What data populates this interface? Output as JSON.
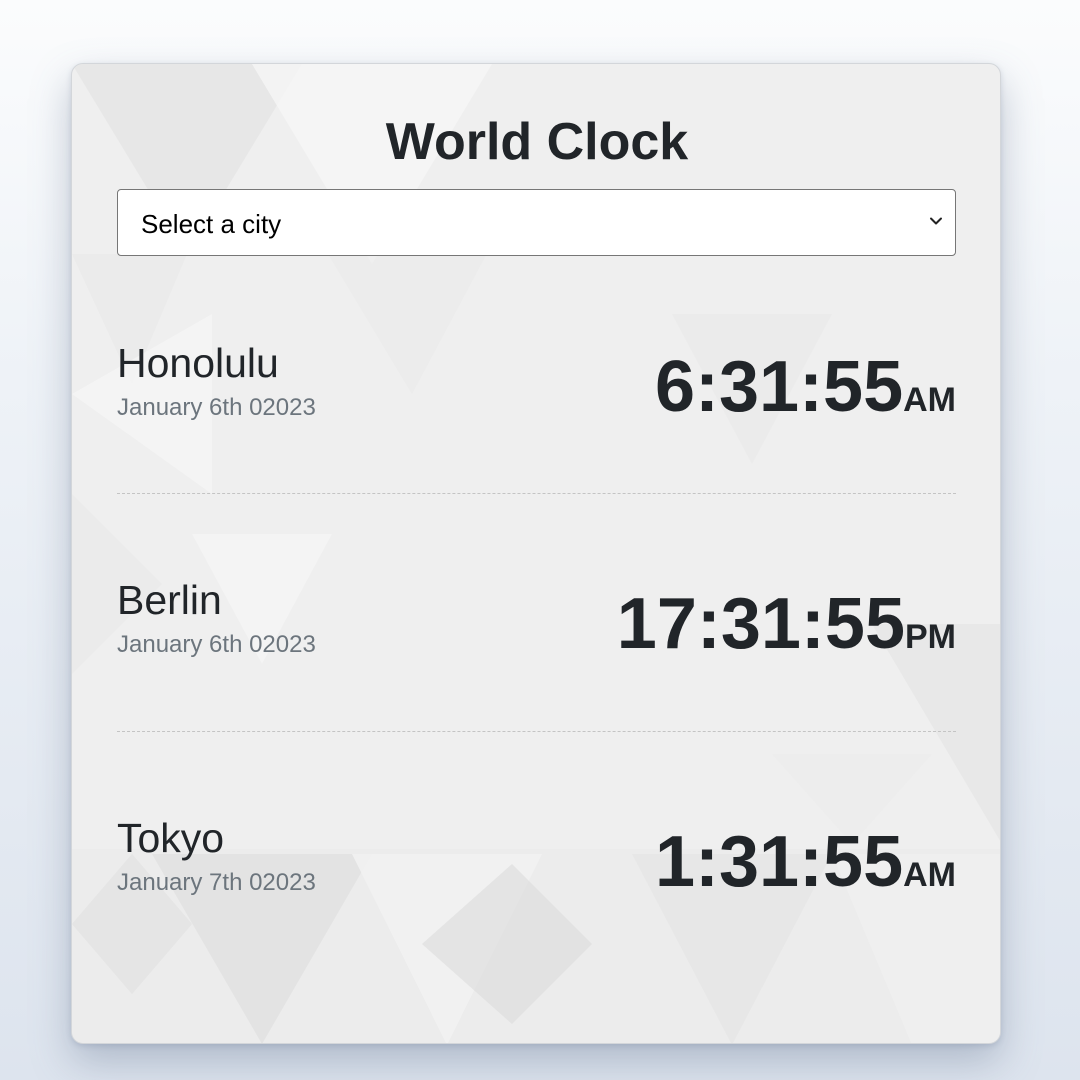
{
  "app": {
    "title": "World Clock"
  },
  "city_select": {
    "selected_label": "Select a city",
    "icon": "chevron-down-icon"
  },
  "clocks": [
    {
      "city": "Honolulu",
      "date": "January 6th 02023",
      "time": "6:31:55",
      "period": "AM"
    },
    {
      "city": "Berlin",
      "date": "January 6th 02023",
      "time": "17:31:55",
      "period": "PM"
    },
    {
      "city": "Tokyo",
      "date": "January 7th 02023",
      "time": "1:31:55",
      "period": "AM"
    }
  ],
  "colors": {
    "text_primary": "#212529",
    "text_muted": "#6c757d",
    "card_background": "#efefef"
  }
}
